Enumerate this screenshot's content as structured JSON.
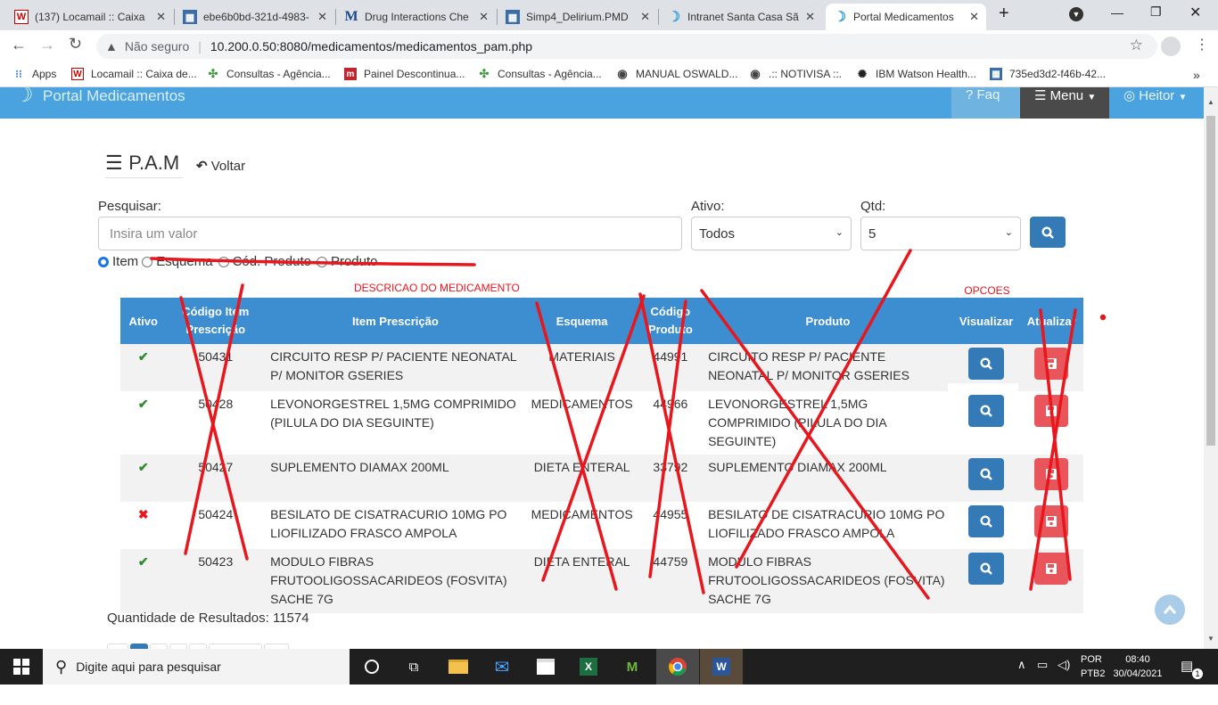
{
  "browser": {
    "tabs": [
      {
        "title": "(137) Locamail :: Caixa",
        "icon": "locaweb-w-icon"
      },
      {
        "title": "ebe6b0bd-321d-4983-",
        "icon": "file-icon"
      },
      {
        "title": "Drug Interactions Che",
        "icon": "medscape-m-icon"
      },
      {
        "title": "Simp4_Delirium.PMD",
        "icon": "file-icon"
      },
      {
        "title": "Intranet Santa Casa Sã",
        "icon": "santa-casa-icon"
      },
      {
        "title": "Portal Medicamentos",
        "icon": "santa-casa-icon"
      }
    ],
    "security": "Não seguro",
    "url": "10.200.0.50:8080/medicamentos/medicamentos_pam.php",
    "bookmarks": [
      {
        "label": "Apps",
        "icon": "apps-grid-icon"
      },
      {
        "label": "Locamail :: Caixa de...",
        "icon": "locaweb-w-icon"
      },
      {
        "label": "Consultas - Agência...",
        "icon": "anvisa-icon"
      },
      {
        "label": "Painel Descontinua...",
        "icon": "painel-m-icon"
      },
      {
        "label": "Consultas - Agência...",
        "icon": "anvisa-icon"
      },
      {
        "label": "MANUAL OSWALD...",
        "icon": "globe-icon"
      },
      {
        "label": ".:: NOTIVISA ::.",
        "icon": "globe-icon"
      },
      {
        "label": "IBM Watson Health...",
        "icon": "watson-icon"
      },
      {
        "label": "735ed3d2-f46b-42...",
        "icon": "file-icon"
      }
    ],
    "more": "»"
  },
  "portal": {
    "title": "Portal Medicamentos",
    "nav": {
      "faq": "Faq",
      "menu": "Menu",
      "user": "Heitor"
    }
  },
  "pam": {
    "title": "P.A.M",
    "back": "Voltar",
    "search_label": "Pesquisar:",
    "search_placeholder": "Insira um valor",
    "ativo_label": "Ativo:",
    "ativo_value": "Todos",
    "qtd_label": "Qtd:",
    "qtd_value": "5",
    "radios": [
      "Item",
      "Esquema",
      "Cód. Produto",
      "Produto"
    ],
    "annotation_desc": "DESCRICAO DO MEDICAMENTO",
    "annotation_opcoes": "OPCOES",
    "columns": [
      "Ativo",
      "Código Item Prescrição",
      "Item Prescrição",
      "Esquema",
      "Código Produto",
      "Produto",
      "Visualizar",
      "Atualizar"
    ],
    "rows": [
      {
        "ativo": "✔",
        "ativo_state": "yes",
        "codigo": "50431",
        "item": "CIRCUITO RESP P/ PACIENTE NEONATAL P/ MONITOR GSERIES",
        "esquema": "MATERIAIS",
        "cod_prod": "44991",
        "produto": "CIRCUITO RESP P/ PACIENTE NEONATAL P/ MONITOR GSERIES"
      },
      {
        "ativo": "✔",
        "ativo_state": "yes",
        "codigo": "50428",
        "item": "LEVONORGESTREL 1,5MG COMPRIMIDO (PILULA DO DIA SEGUINTE)",
        "esquema": "MEDICAMENTOS",
        "cod_prod": "44966",
        "produto": "LEVONORGESTREL 1,5MG COMPRIMIDO (PILULA DO DIA SEGUINTE)"
      },
      {
        "ativo": "✔",
        "ativo_state": "yes",
        "codigo": "50427",
        "item": "SUPLEMENTO DIAMAX 200ML",
        "esquema": "DIETA ENTERAL",
        "cod_prod": "33792",
        "produto": "SUPLEMENTO DIAMAX 200ML"
      },
      {
        "ativo": "✖",
        "ativo_state": "no",
        "codigo": "50424",
        "item": "BESILATO DE CISATRACURIO 10MG PO LIOFILIZADO FRASCO AMPOLA",
        "esquema": "MEDICAMENTOS",
        "cod_prod": "44955",
        "produto": "BESILATO DE CISATRACURIO 10MG PO LIOFILIZADO FRASCO AMPOLA"
      },
      {
        "ativo": "✔",
        "ativo_state": "yes",
        "codigo": "50423",
        "item": "MODULO FIBRAS FRUTOOLIGOSSACARIDEOS (FOSVITA) SACHE 7G",
        "esquema": "DIETA ENTERAL",
        "cod_prod": "44759",
        "produto": "MODULO FIBRAS FRUTOOLIGOSSACARIDEOS (FOSVITA) SACHE 7G"
      }
    ],
    "result_count": "Quantidade de Resultados: 11574"
  },
  "taskbar": {
    "search_placeholder": "Digite aqui para pesquisar",
    "lang1": "POR",
    "lang2": "PTB2",
    "time": "08:40",
    "date": "30/04/2021",
    "notif_count": "1"
  },
  "colors": {
    "navbar": "#4aa3df",
    "header": "#3d8ed1",
    "view_btn": "#337ab7",
    "update_btn": "#e8555b",
    "annotation": "#e8161d",
    "check": "#2e8b2e"
  }
}
